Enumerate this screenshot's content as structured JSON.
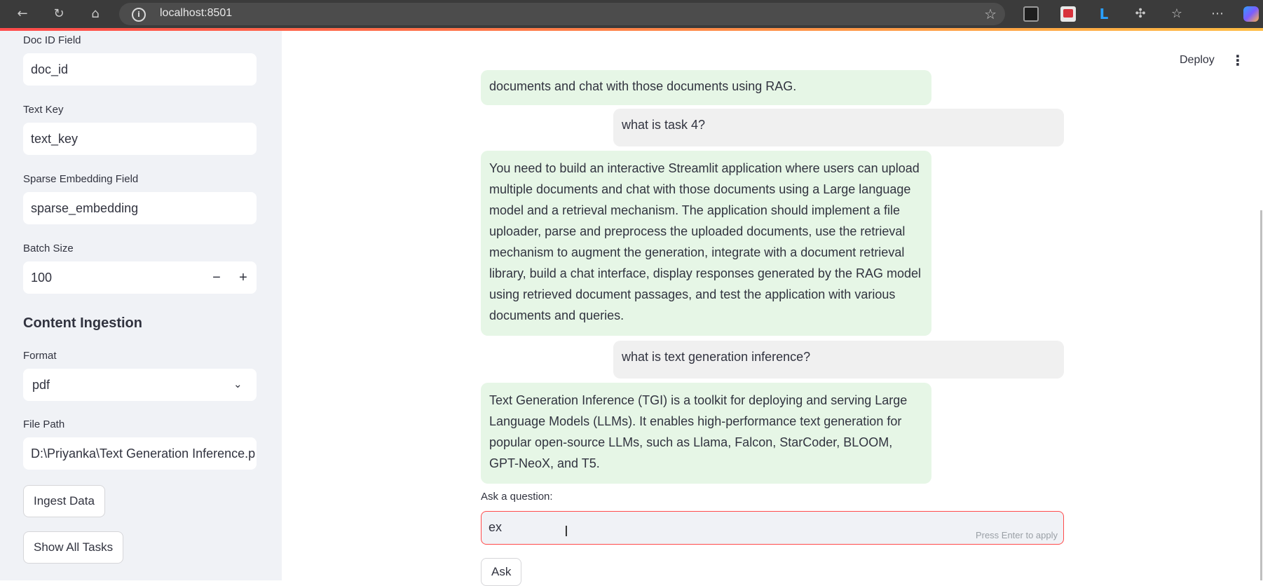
{
  "browser": {
    "url": "localhost:8501",
    "back_icon": "back-arrow-icon",
    "reload_icon": "reload-icon",
    "home_icon": "home-icon"
  },
  "sidebar": {
    "doc_id": {
      "label": "Doc ID Field",
      "value": "doc_id"
    },
    "text_key": {
      "label": "Text Key",
      "value": "text_key"
    },
    "sparse": {
      "label": "Sparse Embedding Field",
      "value": "sparse_embedding"
    },
    "batch": {
      "label": "Batch Size",
      "value": "100",
      "minus": "−",
      "plus": "+"
    },
    "section_title": "Content Ingestion",
    "format": {
      "label": "Format",
      "value": "pdf"
    },
    "file_path": {
      "label": "File Path",
      "value": "D:\\Priyanka\\Text Generation Inference.p"
    },
    "ingest_label": "Ingest Data",
    "show_tasks_label": "Show All Tasks"
  },
  "header": {
    "deploy_label": "Deploy",
    "menu_glyph": "⋮"
  },
  "chat": {
    "messages": [
      {
        "role": "assistant",
        "text": "documents and chat with those documents using RAG."
      },
      {
        "role": "user",
        "text": "what is task 4?"
      },
      {
        "role": "assistant",
        "text": "You need to build an interactive Streamlit application where users can upload multiple documents and chat with those documents using a Large language model and a retrieval mechanism. The application should implement a file uploader, parse and preprocess the uploaded documents, use the retrieval mechanism to augment the generation, integrate with a document retrieval library, build a chat interface, display responses generated by the RAG model using retrieved document passages, and test the application with various documents and queries."
      },
      {
        "role": "user",
        "text": "what is text generation inference?"
      },
      {
        "role": "assistant",
        "text": "Text Generation Inference (TGI) is a toolkit for deploying and serving Large Language Models (LLMs). It enables high-performance text generation for popular open-source LLMs, such as Llama, Falcon, StarCoder, BLOOM, GPT-NeoX, and T5."
      }
    ],
    "ask_label": "Ask a question:",
    "input_value": "ex",
    "input_hint": "Press Enter to apply",
    "ask_button": "Ask"
  },
  "colors": {
    "accent": "#ff4b4b",
    "assistant_bg": "#e6f6e6",
    "user_bg": "#f0f0f0",
    "sidebar_bg": "#f0f2f6"
  }
}
